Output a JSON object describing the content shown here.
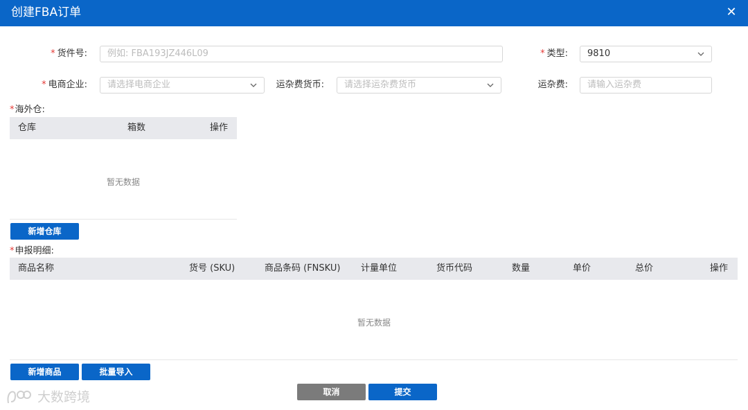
{
  "header": {
    "title": "创建FBA订单",
    "close_glyph": "✕"
  },
  "form": {
    "cargo_no": {
      "label": "货件号:",
      "placeholder": "例如: FBA193JZ446L09"
    },
    "type": {
      "label": "类型:",
      "value": "9810"
    },
    "ecommerce": {
      "label": "电商企业:",
      "placeholder": "请选择电商企业"
    },
    "freight_currency": {
      "label": "运杂费货币:",
      "placeholder": "请选择运杂费货币"
    },
    "freight": {
      "label": "运杂费:",
      "placeholder": "请输入运杂费"
    }
  },
  "warehouse": {
    "section_label": "海外仓:",
    "columns": [
      "仓库",
      "箱数",
      "操作"
    ],
    "empty_text": "暂无数据",
    "add_button": "新增仓库"
  },
  "declaration": {
    "section_label": "申报明细:",
    "columns": [
      "商品名称",
      "货号 (SKU)",
      "商品条码 (FNSKU)",
      "计量单位",
      "货币代码",
      "数量",
      "单价",
      "总价",
      "操作"
    ],
    "empty_text": "暂无数据",
    "add_button": "新增商品",
    "import_button": "批量导入"
  },
  "footer": {
    "cancel": "取消",
    "submit": "提交"
  },
  "watermark": {
    "text": "大数跨境"
  },
  "colors": {
    "primary": "#0a66c8",
    "required": "#e53935",
    "cancel": "#7b7b7b",
    "table_header": "#e8e9ed"
  }
}
